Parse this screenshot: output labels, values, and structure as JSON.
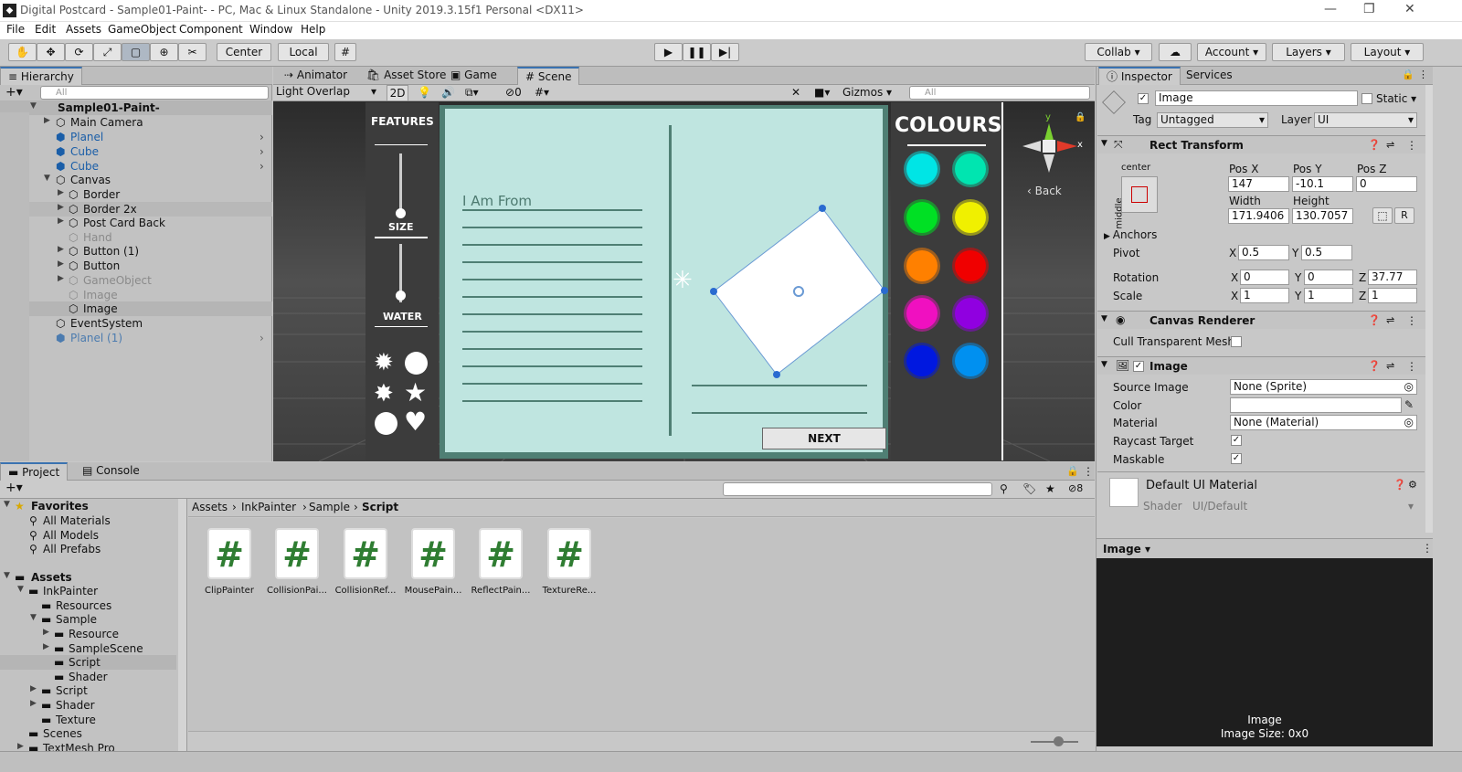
{
  "title": "Digital Postcard - Sample01-Paint- - PC, Mac & Linux Standalone - Unity 2019.3.15f1 Personal <DX11>",
  "window_controls": {
    "minimize": "—",
    "restore": "❐",
    "close": "✕"
  },
  "menu": [
    "File",
    "Edit",
    "Assets",
    "GameObject",
    "Component",
    "Window",
    "Help"
  ],
  "toolbar": {
    "center": "Center",
    "local": "Local",
    "collab": "Collab ▾",
    "account": "Account",
    "layers": "Layers",
    "layout": "Layout"
  },
  "hierarchy": {
    "tab": "Hierarchy",
    "search": "All",
    "scene": "Sample01-Paint-",
    "items": [
      {
        "label": "Main Camera"
      },
      {
        "label": "Planel"
      },
      {
        "label": "Cube"
      },
      {
        "label": "Cube"
      },
      {
        "label": "Canvas"
      },
      {
        "label": "Border"
      },
      {
        "label": "Border 2x"
      },
      {
        "label": "Post Card Back"
      },
      {
        "label": "Hand"
      },
      {
        "label": "Button (1)"
      },
      {
        "label": "Button"
      },
      {
        "label": "GameObject"
      },
      {
        "label": "Image"
      },
      {
        "label": "Image"
      },
      {
        "label": "EventSystem"
      },
      {
        "label": "Planel (1)"
      }
    ]
  },
  "scene_tabs": [
    "Animator",
    "Asset Store",
    "Game",
    "Scene"
  ],
  "scene_toolbar": {
    "mode": "Light Overlap",
    "twod": "2D",
    "hidden_count": "0",
    "gizmos": "Gizmos",
    "search": "All"
  },
  "scene": {
    "features": "FEATURES",
    "size": "SIZE",
    "water": "WATER",
    "colours": "COLOURS",
    "i_am_from": "I Am From",
    "next": "NEXT",
    "back": "Back",
    "gizmo_y": "y",
    "gizmo_x": "x",
    "colors": [
      "#00e5e5",
      "#00e5b0",
      "#00e024",
      "#f0f000",
      "#ff8000",
      "#f00000",
      "#f010c0",
      "#9000e0",
      "#0018e0",
      "#0090f0"
    ]
  },
  "inspector": {
    "tabs": [
      "Inspector",
      "Services"
    ],
    "name": "Image",
    "static": "Static",
    "tag_label": "Tag",
    "tag": "Untagged",
    "layer_label": "Layer",
    "layer": "UI",
    "rect": {
      "title": "Rect Transform",
      "anchor_h": "center",
      "anchor_v": "middle",
      "posx_l": "Pos X",
      "posy_l": "Pos Y",
      "posz_l": "Pos Z",
      "posx": "147",
      "posy": "-10.1",
      "posz": "0",
      "width_l": "Width",
      "height_l": "Height",
      "width": "171.9406",
      "height": "130.7057",
      "r": "R",
      "anchors": "Anchors",
      "pivot": "Pivot",
      "pivot_x": "0.5",
      "pivot_y": "0.5",
      "rotation": "Rotation",
      "rot_x": "0",
      "rot_y": "0",
      "rot_z": "37.77",
      "scale": "Scale",
      "sc_x": "1",
      "sc_y": "1",
      "sc_z": "1",
      "x": "X",
      "y": "Y",
      "z": "Z"
    },
    "canvas_renderer": {
      "title": "Canvas Renderer",
      "cull": "Cull Transparent Mesh"
    },
    "image": {
      "title": "Image",
      "source_l": "Source Image",
      "source": "None (Sprite)",
      "color_l": "Color",
      "material_l": "Material",
      "material": "None (Material)",
      "raycast": "Raycast Target",
      "maskable": "Maskable"
    },
    "material": {
      "name": "Default UI Material",
      "shader_l": "Shader",
      "shader": "UI/Default"
    },
    "preview": {
      "label": "Image",
      "caption": "Image",
      "size": "Image Size: 0x0"
    }
  },
  "project": {
    "tabs": [
      "Project",
      "Console"
    ],
    "hidden_count": "8",
    "favorites": "Favorites",
    "fav_items": [
      "All Materials",
      "All Models",
      "All Prefabs"
    ],
    "assets": "Assets",
    "tree": [
      "InkPainter",
      "Resources",
      "Sample",
      "Resource",
      "SampleScene",
      "Script",
      "Shader",
      "Script",
      "Shader",
      "Texture",
      "Scenes",
      "TextMesh Pro"
    ],
    "breadcrumb": [
      "Assets",
      "InkPainter",
      "Sample",
      "Script"
    ],
    "files": [
      "ClipPainter",
      "CollisionPai...",
      "CollisionRef...",
      "MousePain...",
      "ReflectPain...",
      "TextureRe..."
    ]
  }
}
